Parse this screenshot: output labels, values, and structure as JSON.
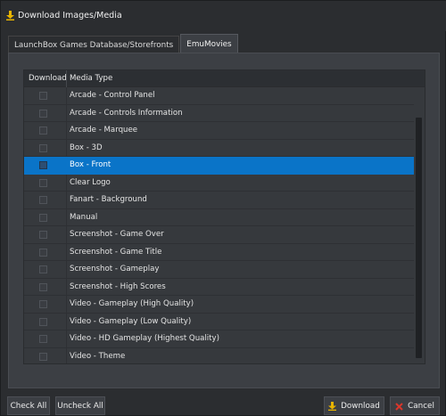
{
  "window": {
    "title": "Download Images/Media",
    "title_icon": "download-arrow-icon"
  },
  "tabs": [
    {
      "label": "LaunchBox Games Database/Storefronts",
      "active": false
    },
    {
      "label": "EmuMovies",
      "active": true
    }
  ],
  "grid": {
    "columns": {
      "download": "Download",
      "media_type": "Media Type"
    },
    "rows": [
      {
        "label": "Arcade - Control Panel",
        "checked": false,
        "selected": false
      },
      {
        "label": "Arcade - Controls Information",
        "checked": false,
        "selected": false
      },
      {
        "label": "Arcade - Marquee",
        "checked": false,
        "selected": false
      },
      {
        "label": "Box - 3D",
        "checked": false,
        "selected": false
      },
      {
        "label": "Box - Front",
        "checked": false,
        "selected": true
      },
      {
        "label": "Clear Logo",
        "checked": false,
        "selected": false
      },
      {
        "label": "Fanart - Background",
        "checked": false,
        "selected": false
      },
      {
        "label": "Manual",
        "checked": false,
        "selected": false
      },
      {
        "label": "Screenshot - Game Over",
        "checked": false,
        "selected": false
      },
      {
        "label": "Screenshot - Game Title",
        "checked": false,
        "selected": false
      },
      {
        "label": "Screenshot - Gameplay",
        "checked": false,
        "selected": false
      },
      {
        "label": "Screenshot - High Scores",
        "checked": false,
        "selected": false
      },
      {
        "label": "Video - Gameplay (High Quality)",
        "checked": false,
        "selected": false
      },
      {
        "label": "Video - Gameplay (Low Quality)",
        "checked": false,
        "selected": false
      },
      {
        "label": "Video - HD Gameplay (Highest Quality)",
        "checked": false,
        "selected": false
      },
      {
        "label": "Video - Theme",
        "checked": false,
        "selected": false
      }
    ]
  },
  "buttons": {
    "check_all": "Check All",
    "uncheck_all": "Uncheck All",
    "download": "Download",
    "cancel": "Cancel"
  },
  "colors": {
    "selection": "#0a74c8",
    "background": "#2b2d30",
    "panel": "#3c3f44",
    "download_icon": "#e8b400",
    "cancel_icon": "#d9362b"
  }
}
